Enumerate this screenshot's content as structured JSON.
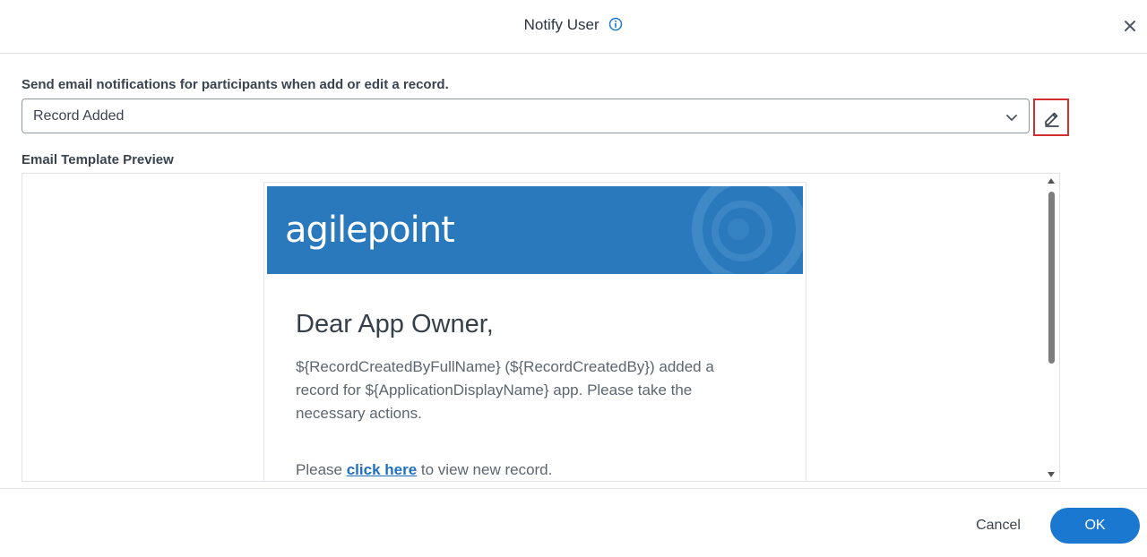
{
  "dialog": {
    "title": "Notify User",
    "info_icon": "info-icon",
    "close_icon": "close-icon"
  },
  "notification": {
    "label": "Send email notifications for participants when add or edit a record.",
    "selected": "Record Added",
    "edit_icon": "pencil-icon"
  },
  "preview": {
    "label": "Email Template Preview",
    "logo": "agilepoint",
    "greeting": "Dear App Owner,",
    "body": "${RecordCreatedByFullName} (${RecordCreatedBy}) added a record for ${ApplicationDisplayName} app. Please take the necessary actions.",
    "click_prefix": "Please",
    "click_link": "click here",
    "click_suffix": "to view new record."
  },
  "footer": {
    "cancel": "Cancel",
    "ok": "OK"
  },
  "colors": {
    "primary": "#1b78d0",
    "banner": "#2a79bd",
    "highlight_border": "#d32f2f"
  }
}
